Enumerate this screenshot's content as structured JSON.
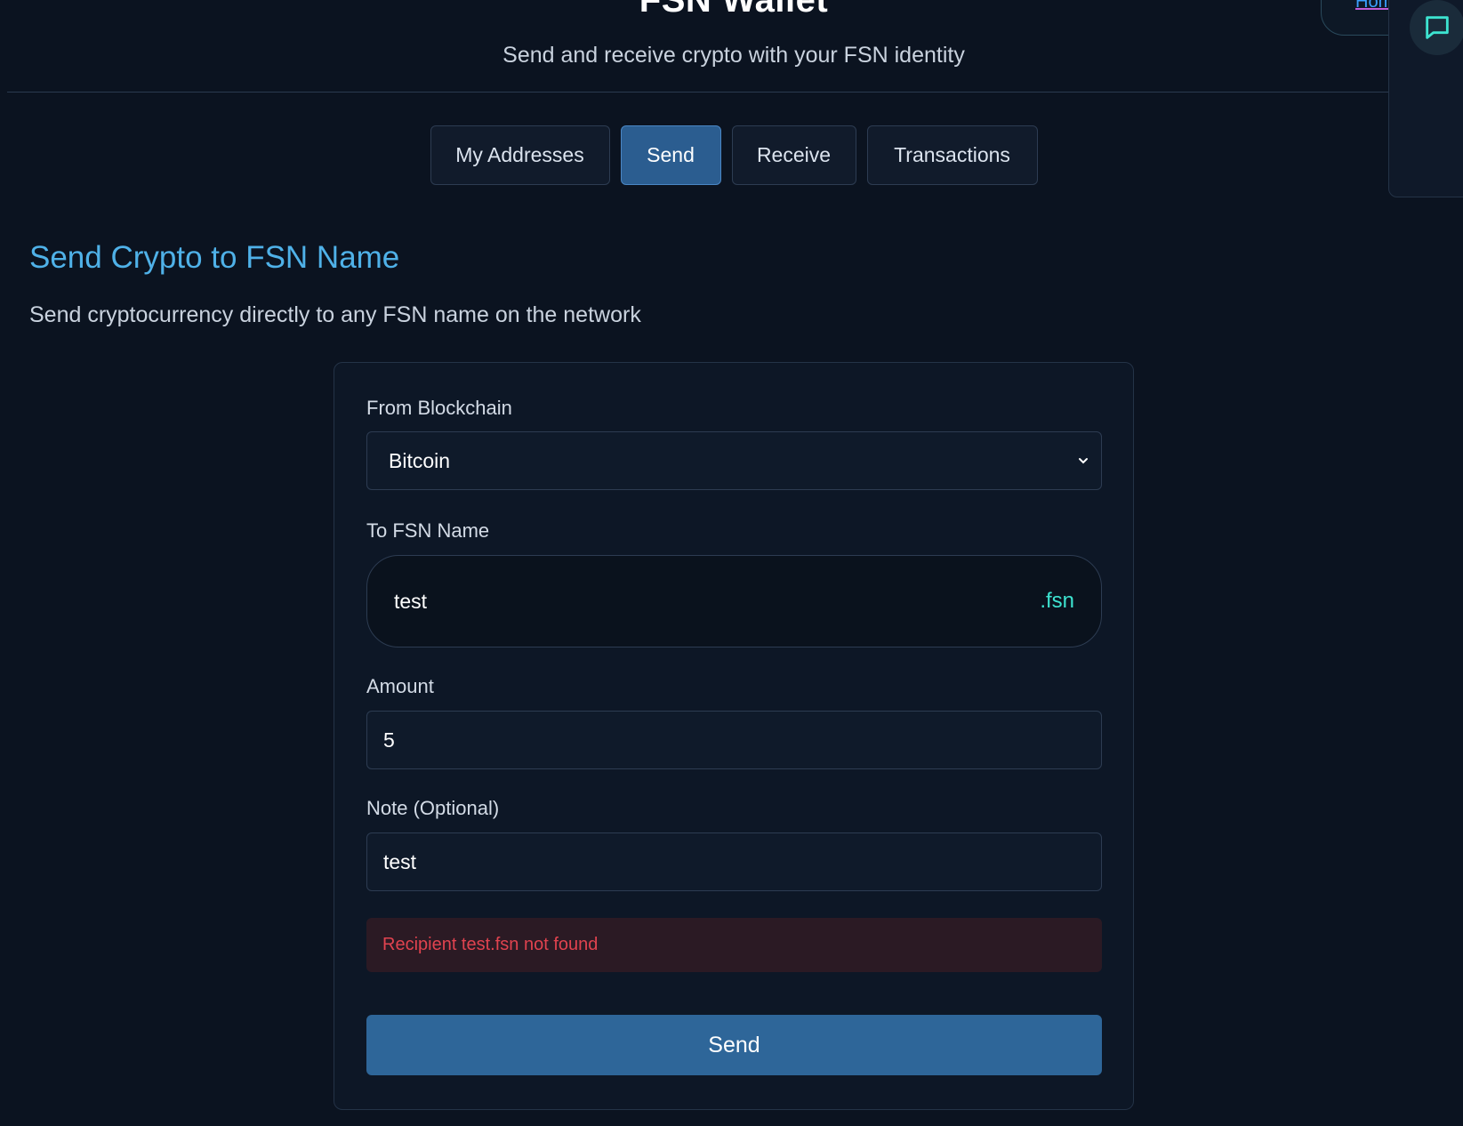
{
  "header": {
    "title": "FSN Wallet",
    "subtitle": "Send and receive crypto with your FSN identity",
    "home_link": "Home"
  },
  "tabs": [
    {
      "label": "My Addresses",
      "active": false
    },
    {
      "label": "Send",
      "active": true
    },
    {
      "label": "Receive",
      "active": false
    },
    {
      "label": "Transactions",
      "active": false
    }
  ],
  "section": {
    "title": "Send Crypto to FSN Name",
    "description": "Send cryptocurrency directly to any FSN name on the network"
  },
  "form": {
    "from_label": "From Blockchain",
    "from_value": "Bitcoin",
    "to_label": "To FSN Name",
    "to_value": "test",
    "to_suffix": ".fsn",
    "amount_label": "Amount",
    "amount_value": "5",
    "note_label": "Note (Optional)",
    "note_value": "test",
    "error": "Recipient test.fsn not found",
    "submit_label": "Send"
  },
  "icons": {
    "chat": "chat-bubble-icon",
    "dropdown": "chevron-down-icon"
  },
  "colors": {
    "background": "#0b1320",
    "accent": "#4fb1e8",
    "active_tab": "#2b5d90",
    "send_button": "#2e6699",
    "error_text": "#e0434f",
    "fsn_suffix": "#3de3d0"
  }
}
